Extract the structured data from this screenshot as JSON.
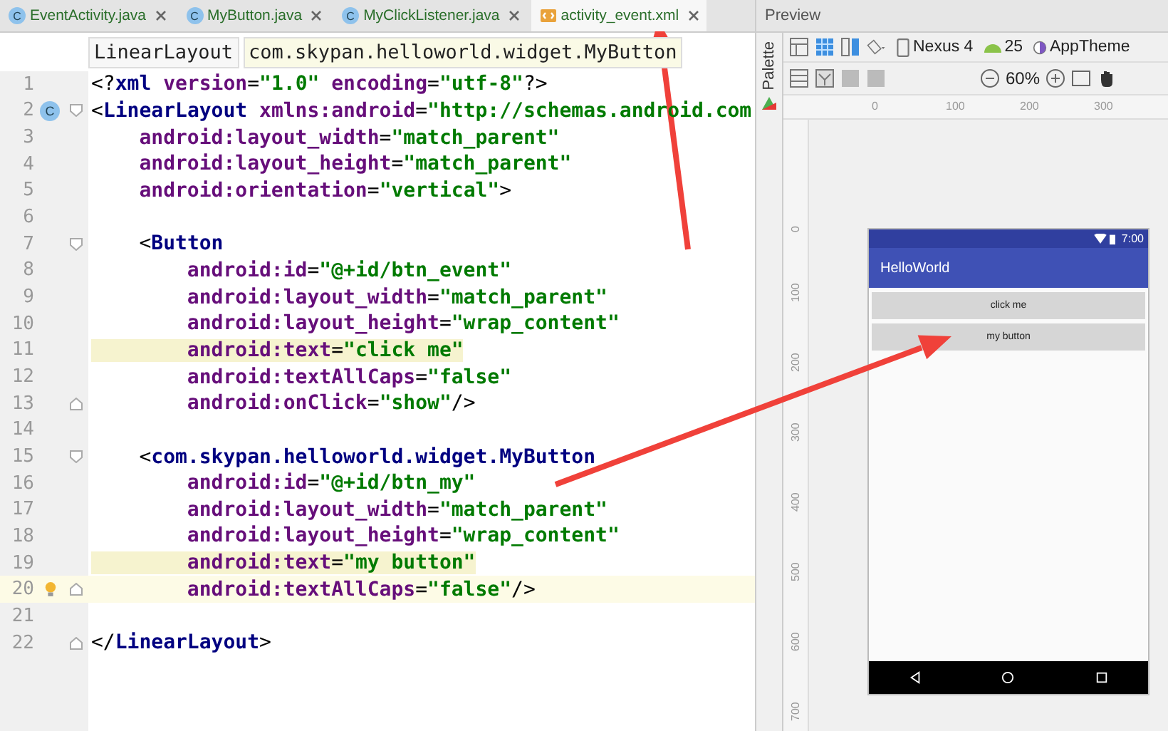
{
  "tabs": [
    {
      "label": "EventActivity.java",
      "kind": "java",
      "badge": "C",
      "selected": false
    },
    {
      "label": "MyButton.java",
      "kind": "java",
      "badge": "C",
      "selected": false
    },
    {
      "label": "MyClickListener.java",
      "kind": "java",
      "badge": "C",
      "selected": false
    },
    {
      "label": "activity_event.xml",
      "kind": "xml",
      "selected": true
    }
  ],
  "breadcrumbs": [
    {
      "label": "LinearLayout",
      "selected": false
    },
    {
      "label": "com.skypan.helloworld.widget.MyButton",
      "selected": true
    }
  ],
  "lines": [
    {
      "n": "1",
      "code": [
        {
          "kind": "punct",
          "text": "<?"
        },
        {
          "kind": "tag",
          "text": "xml "
        },
        {
          "kind": "attr",
          "text": "version"
        },
        {
          "kind": "punct",
          "text": "="
        },
        {
          "kind": "value",
          "text": "\"1.0\""
        },
        {
          "kind": "attr",
          "text": " encoding"
        },
        {
          "kind": "punct",
          "text": "="
        },
        {
          "kind": "value",
          "text": "\"utf-8\""
        },
        {
          "kind": "punct",
          "text": "?>"
        }
      ]
    },
    {
      "n": "2",
      "badge": "C",
      "fold_start": true,
      "code": [
        {
          "kind": "punct",
          "text": "<"
        },
        {
          "kind": "tag",
          "text": "LinearLayout "
        },
        {
          "kind": "attr",
          "text": "xmlns:android"
        },
        {
          "kind": "punct",
          "text": "="
        },
        {
          "kind": "value",
          "text": "\"http://schemas.android.com"
        }
      ]
    },
    {
      "n": "3",
      "code": [
        {
          "kind": "attr",
          "text": "    android:layout_width"
        },
        {
          "kind": "punct",
          "text": "="
        },
        {
          "kind": "value",
          "text": "\"match_parent\""
        }
      ]
    },
    {
      "n": "4",
      "code": [
        {
          "kind": "attr",
          "text": "    android:layout_height"
        },
        {
          "kind": "punct",
          "text": "="
        },
        {
          "kind": "value",
          "text": "\"match_parent\""
        }
      ]
    },
    {
      "n": "5",
      "code": [
        {
          "kind": "attr",
          "text": "    android:orientation"
        },
        {
          "kind": "punct",
          "text": "="
        },
        {
          "kind": "value",
          "text": "\"vertical\""
        },
        {
          "kind": "punct",
          "text": ">"
        }
      ]
    },
    {
      "n": "6"
    },
    {
      "n": "7",
      "fold_start": true,
      "code": [
        {
          "kind": "punct",
          "text": "    <"
        },
        {
          "kind": "tag",
          "text": "Button"
        }
      ]
    },
    {
      "n": "8",
      "code": [
        {
          "kind": "attr",
          "text": "        android:id"
        },
        {
          "kind": "punct",
          "text": "="
        },
        {
          "kind": "value",
          "text": "\"@+id/btn_event\""
        }
      ]
    },
    {
      "n": "9",
      "code": [
        {
          "kind": "attr",
          "text": "        android:layout_width"
        },
        {
          "kind": "punct",
          "text": "="
        },
        {
          "kind": "value",
          "text": "\"match_parent\""
        }
      ]
    },
    {
      "n": "10",
      "code": [
        {
          "kind": "attr",
          "text": "        android:layout_height"
        },
        {
          "kind": "punct",
          "text": "="
        },
        {
          "kind": "value",
          "text": "\"wrap_content\""
        }
      ]
    },
    {
      "n": "11",
      "marked": true,
      "code": [
        {
          "kind": "attr",
          "text": "        android:text"
        },
        {
          "kind": "punct",
          "text": "="
        },
        {
          "kind": "value",
          "text": "\"click me\""
        }
      ]
    },
    {
      "n": "12",
      "code": [
        {
          "kind": "attr",
          "text": "        android:textAllCaps"
        },
        {
          "kind": "punct",
          "text": "="
        },
        {
          "kind": "value",
          "text": "\"false\""
        }
      ]
    },
    {
      "n": "13",
      "fold_end": true,
      "code": [
        {
          "kind": "attr",
          "text": "        android:onClick"
        },
        {
          "kind": "punct",
          "text": "="
        },
        {
          "kind": "value",
          "text": "\"show\""
        },
        {
          "kind": "punct",
          "text": "/>"
        }
      ]
    },
    {
      "n": "14"
    },
    {
      "n": "15",
      "fold_start": true,
      "code": [
        {
          "kind": "punct",
          "text": "    <"
        },
        {
          "kind": "tag",
          "text": "com.skypan.helloworld.widget.MyButton"
        }
      ]
    },
    {
      "n": "16",
      "code": [
        {
          "kind": "attr",
          "text": "        android:id"
        },
        {
          "kind": "punct",
          "text": "="
        },
        {
          "kind": "value",
          "text": "\"@+id/btn_my\""
        }
      ]
    },
    {
      "n": "17",
      "code": [
        {
          "kind": "attr",
          "text": "        android:layout_width"
        },
        {
          "kind": "punct",
          "text": "="
        },
        {
          "kind": "value",
          "text": "\"match_parent\""
        }
      ]
    },
    {
      "n": "18",
      "code": [
        {
          "kind": "attr",
          "text": "        android:layout_height"
        },
        {
          "kind": "punct",
          "text": "="
        },
        {
          "kind": "value",
          "text": "\"wrap_content\""
        }
      ]
    },
    {
      "n": "19",
      "marked": true,
      "code": [
        {
          "kind": "attr",
          "text": "        android:text"
        },
        {
          "kind": "punct",
          "text": "="
        },
        {
          "kind": "value",
          "text": "\"my button\""
        }
      ]
    },
    {
      "n": "20",
      "current": true,
      "bulb": true,
      "fold_end": true,
      "code": [
        {
          "kind": "attr",
          "text": "        android:textAllCaps"
        },
        {
          "kind": "punct",
          "text": "="
        },
        {
          "kind": "value",
          "text": "\"false\""
        },
        {
          "kind": "punct",
          "text": "/>"
        }
      ]
    },
    {
      "n": "21"
    },
    {
      "n": "22",
      "fold_end": true,
      "code": [
        {
          "kind": "punct",
          "text": "</"
        },
        {
          "kind": "tag",
          "text": "LinearLayout"
        },
        {
          "kind": "punct",
          "text": ">"
        }
      ]
    }
  ],
  "preview": {
    "title": "Preview",
    "palette": "Palette",
    "device": "Nexus 4",
    "api": "25",
    "theme": "AppTheme",
    "zoom": "60%",
    "h_ruler": [
      "0",
      "100",
      "200",
      "300"
    ],
    "v_ruler": [
      "0",
      "100",
      "200",
      "300",
      "400",
      "500",
      "600",
      "700"
    ],
    "phone": {
      "time": "7:00",
      "app_title": "HelloWorld",
      "buttons": [
        "click me",
        "my button"
      ]
    }
  }
}
